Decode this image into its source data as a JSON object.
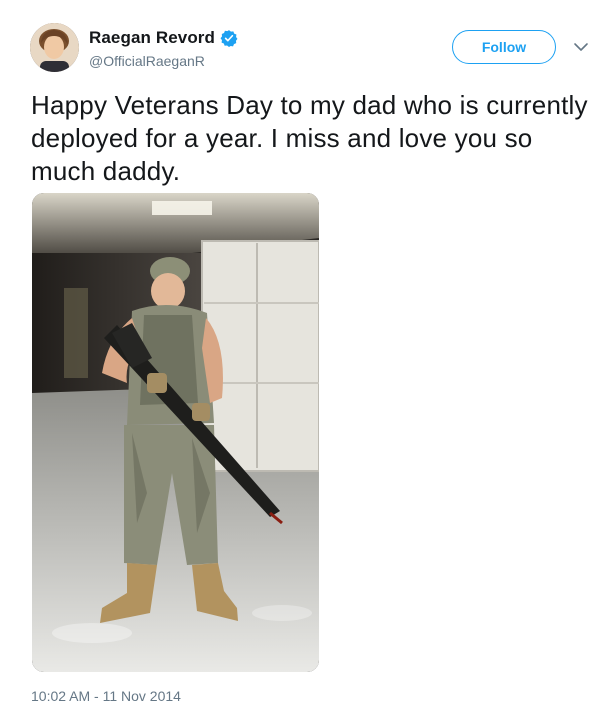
{
  "author": {
    "display_name": "Raegan Revord",
    "handle": "@OfficialRaeganR",
    "verified": true
  },
  "follow_button": {
    "label": "Follow"
  },
  "menu": {
    "icon": "chevron-down-icon"
  },
  "tweet": {
    "text": "Happy Veterans Day to my dad who is currently deployed for a year. I miss and love you so much daddy.",
    "timestamp": "10:02 AM - 11 Nov 2014"
  },
  "colors": {
    "accent": "#1da1f2",
    "text": "#14171a",
    "secondary_text": "#657786"
  }
}
